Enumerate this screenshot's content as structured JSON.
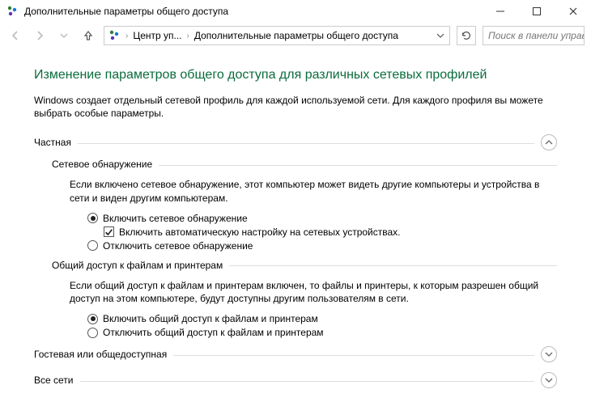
{
  "window": {
    "title": "Дополнительные параметры общего доступа"
  },
  "breadcrumb": {
    "item1": "Центр уп...",
    "item2": "Дополнительные параметры общего доступа"
  },
  "search": {
    "placeholder": "Поиск в панели управления"
  },
  "main": {
    "heading": "Изменение параметров общего доступа для различных сетевых профилей",
    "description": "Windows создает отдельный сетевой профиль для каждой используемой сети. Для каждого профиля вы можете выбрать особые параметры."
  },
  "sections": {
    "private": {
      "title": "Частная",
      "discovery": {
        "title": "Сетевое обнаружение",
        "desc": "Если включено сетевое обнаружение, этот компьютер может видеть другие компьютеры и устройства в сети и виден другим компьютерам.",
        "opt_on": "Включить сетевое обнаружение",
        "opt_auto": "Включить автоматическую настройку на сетевых устройствах.",
        "opt_off": "Отключить сетевое обнаружение"
      },
      "sharing": {
        "title": "Общий доступ к файлам и принтерам",
        "desc": "Если общий доступ к файлам и принтерам включен, то файлы и принтеры, к которым разрешен общий доступ на этом компьютере, будут доступны другим пользователям в сети.",
        "opt_on": "Включить общий доступ к файлам и принтерам",
        "opt_off": "Отключить общий доступ к файлам и принтерам"
      }
    },
    "guest": {
      "title": "Гостевая или общедоступная"
    },
    "all": {
      "title": "Все сети"
    }
  }
}
